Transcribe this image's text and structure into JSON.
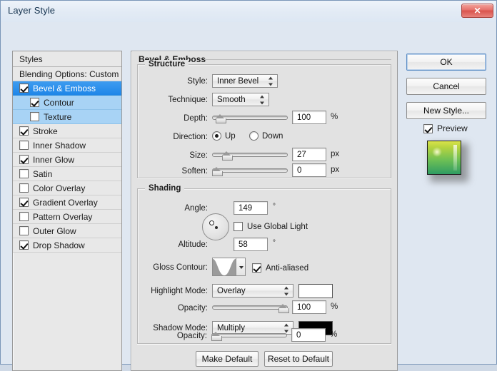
{
  "window": {
    "title": "Layer Style",
    "close_label": "✕"
  },
  "styles_panel": {
    "header": "Styles",
    "items": [
      {
        "label": "Blending Options: Custom",
        "checkbox": false,
        "has_checkbox": false,
        "selected": false,
        "sub": false
      },
      {
        "label": "Bevel & Emboss",
        "checkbox": true,
        "has_checkbox": true,
        "selected": true,
        "sub": false
      },
      {
        "label": "Contour",
        "checkbox": true,
        "has_checkbox": true,
        "selected": false,
        "sub": true
      },
      {
        "label": "Texture",
        "checkbox": false,
        "has_checkbox": true,
        "selected": false,
        "sub": true
      },
      {
        "label": "Stroke",
        "checkbox": true,
        "has_checkbox": true,
        "selected": false,
        "sub": false
      },
      {
        "label": "Inner Shadow",
        "checkbox": false,
        "has_checkbox": true,
        "selected": false,
        "sub": false
      },
      {
        "label": "Inner Glow",
        "checkbox": true,
        "has_checkbox": true,
        "selected": false,
        "sub": false
      },
      {
        "label": "Satin",
        "checkbox": false,
        "has_checkbox": true,
        "selected": false,
        "sub": false
      },
      {
        "label": "Color Overlay",
        "checkbox": false,
        "has_checkbox": true,
        "selected": false,
        "sub": false
      },
      {
        "label": "Gradient Overlay",
        "checkbox": true,
        "has_checkbox": true,
        "selected": false,
        "sub": false
      },
      {
        "label": "Pattern Overlay",
        "checkbox": false,
        "has_checkbox": true,
        "selected": false,
        "sub": false
      },
      {
        "label": "Outer Glow",
        "checkbox": false,
        "has_checkbox": true,
        "selected": false,
        "sub": false
      },
      {
        "label": "Drop Shadow",
        "checkbox": true,
        "has_checkbox": true,
        "selected": false,
        "sub": false
      }
    ]
  },
  "main": {
    "group_title": "Bevel & Emboss",
    "structure": {
      "title": "Structure",
      "style_label": "Style:",
      "style_value": "Inner Bevel",
      "technique_label": "Technique:",
      "technique_value": "Smooth",
      "depth_label": "Depth:",
      "depth_value": "100",
      "depth_unit": "%",
      "depth_percent": 5,
      "direction_label": "Direction:",
      "direction_up": "Up",
      "direction_down": "Down",
      "direction_selected": "Up",
      "size_label": "Size:",
      "size_value": "27",
      "size_unit": "px",
      "size_percent": 15,
      "soften_label": "Soften:",
      "soften_value": "0",
      "soften_unit": "px",
      "soften_percent": 0
    },
    "shading": {
      "title": "Shading",
      "angle_label": "Angle:",
      "angle_value": "149",
      "angle_unit": "°",
      "use_global_light_label": "Use Global Light",
      "use_global_light": false,
      "altitude_label": "Altitude:",
      "altitude_value": "58",
      "altitude_unit": "°",
      "gloss_contour_label": "Gloss Contour:",
      "anti_aliased_label": "Anti-aliased",
      "anti_aliased": true,
      "highlight_mode_label": "Highlight Mode:",
      "highlight_mode_value": "Overlay",
      "highlight_color": "#ffffff",
      "highlight_opacity_label": "Opacity:",
      "highlight_opacity_value": "100",
      "highlight_opacity_unit": "%",
      "highlight_opacity_percent": 100,
      "shadow_mode_label": "Shadow Mode:",
      "shadow_mode_value": "Multiply",
      "shadow_color": "#000000",
      "shadow_opacity_label": "Opacity:",
      "shadow_opacity_value": "0",
      "shadow_opacity_unit": "%",
      "shadow_opacity_percent": 0
    },
    "make_default_label": "Make Default",
    "reset_default_label": "Reset to Default"
  },
  "right": {
    "ok_label": "OK",
    "cancel_label": "Cancel",
    "new_style_label": "New Style...",
    "preview_label": "Preview",
    "preview_checked": true
  },
  "colors": {
    "selected_row": "#1e86e8",
    "sub_row": "#a8d3f5",
    "panel_bg": "#e2e2e2",
    "window_bg": "#dfe7f1",
    "close_red": "#d9534c"
  }
}
